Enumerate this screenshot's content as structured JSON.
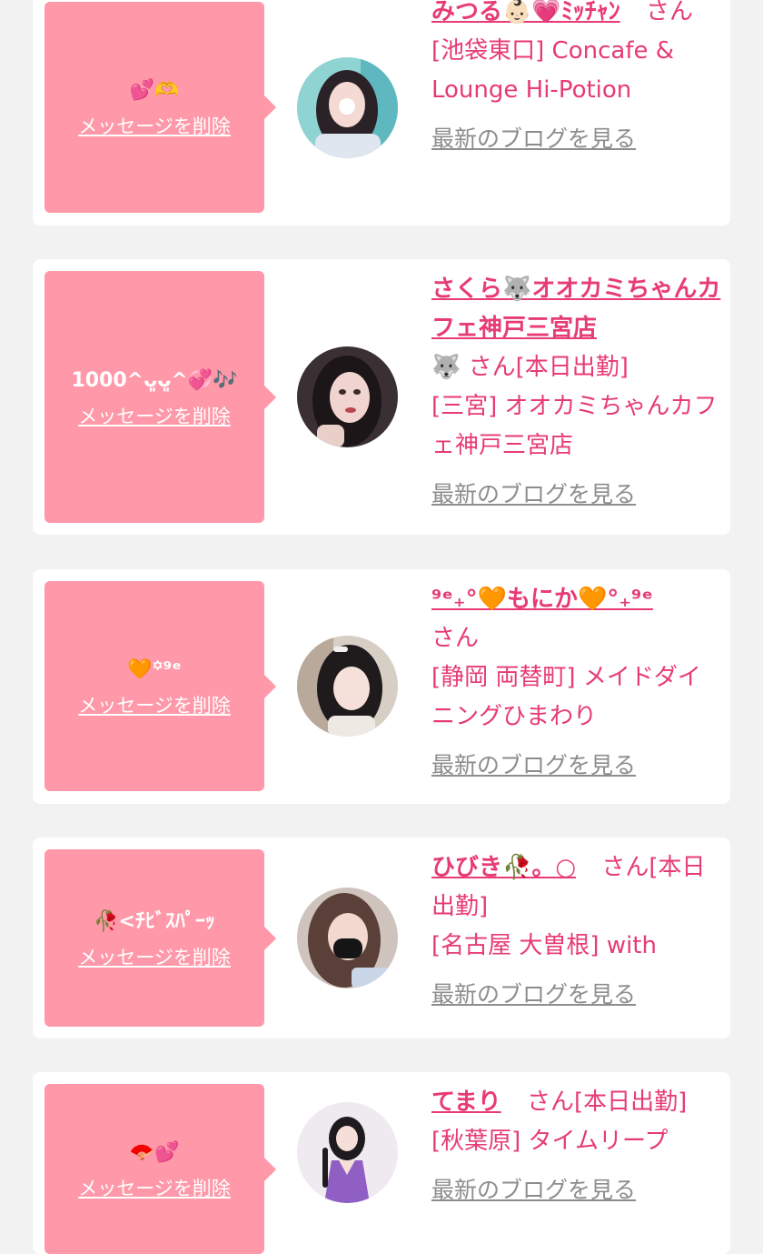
{
  "delete_label": "メッセージを削除",
  "blog_label": "最新のブログを見る",
  "colors": {
    "accent": "#e73b74",
    "bubble": "#ff98a8",
    "muted": "#8d8d8d",
    "background": "#f2f2f2"
  },
  "cards": [
    {
      "message": "💕🫶",
      "name": "みつる👶🏻💗ﾐｯﾁｬﾝ",
      "suffix": "さん",
      "shop": "[池袋東口] Concafe & Lounge Hi-Potion"
    },
    {
      "message": "1000^ᴗ͈ᴗ͈^💞🎶",
      "name": "さくら🐺オオカミちゃんカフェ神戸三宮店",
      "suffix": "🐺 さん[本日出勤]",
      "shop": "[三宮] オオカミちゃんカフェ神戸三宮店"
    },
    {
      "message": "🧡꙳⁹ᵉ",
      "name": "⁹ᵉ₊°🧡もにか🧡°₊⁹ᵉ",
      "suffix": "さん",
      "shop": "[静岡 両替町] メイドダイニングひまわり"
    },
    {
      "message": "🥀<ﾁﾋﾞｽﾊﾟｰｯ",
      "name": "ひびき🥀。○",
      "suffix": "さん[本日出勤]",
      "shop": "[名古屋 大曽根] with"
    },
    {
      "message": "🪭💕",
      "name": "てまり",
      "suffix": "さん[本日出勤]",
      "shop": "[秋葉原] タイムリープ"
    }
  ]
}
